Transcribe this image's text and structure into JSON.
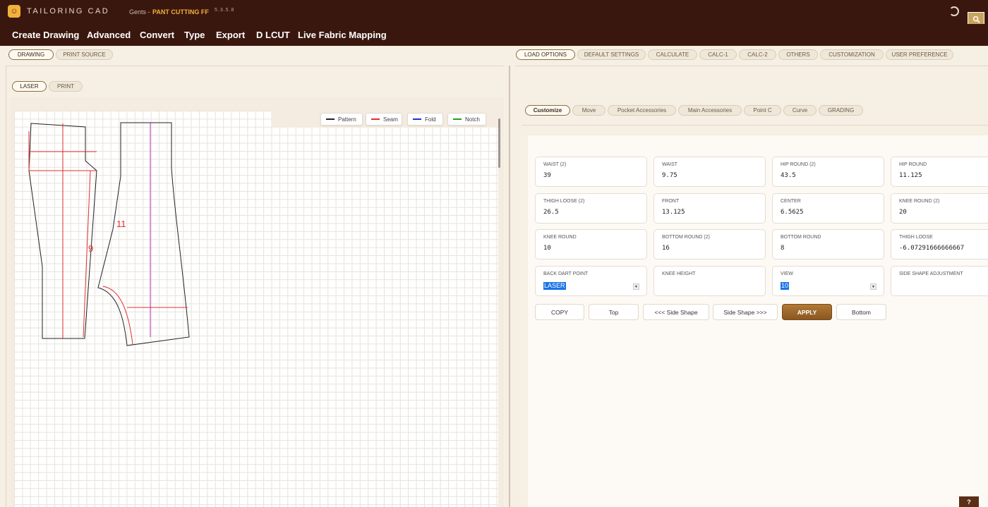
{
  "app": {
    "name": "TAILORING CAD",
    "breadcrumb_parent": "Gents -",
    "breadcrumb_current": "PANT CUTTING FF",
    "version": "5.3.5.8"
  },
  "menu": [
    "Create Drawing",
    "Advanced",
    "Convert",
    "Type",
    "Export",
    "D LCUT",
    "Live Fabric Mapping"
  ],
  "left_tabs": [
    "DRAWING",
    "PRINT SOURCE"
  ],
  "output_tabs": [
    "LASER",
    "PRINT"
  ],
  "right_tabs": [
    "LOAD OPTIONS",
    "DEFAULT SETTINGS",
    "CALCULATE",
    "CALC-1",
    "CALC-2",
    "OTHERS",
    "CUSTOMIZATION",
    "USER PREFERENCE"
  ],
  "sub_tabs": [
    "Customize",
    "Move",
    "Pocket Accessories",
    "Main Accessories",
    "Point C",
    "Curve",
    "GRADING"
  ],
  "legend": [
    {
      "label": "Pattern",
      "color": "#222222"
    },
    {
      "label": "Seam",
      "color": "#e03030"
    },
    {
      "label": "Fold",
      "color": "#2030d0"
    },
    {
      "label": "Notch",
      "color": "#20a020"
    }
  ],
  "pattern_labels": [
    "9",
    "11"
  ],
  "fields": [
    {
      "label": "WAIST (2)",
      "value": "39"
    },
    {
      "label": "WAIST",
      "value": "9.75"
    },
    {
      "label": "HIP ROUND (2)",
      "value": "43.5"
    },
    {
      "label": "HIP ROUND",
      "value": "11.125"
    },
    {
      "label": "THIGH LOOSE (2)",
      "value": "26.5"
    },
    {
      "label": "FRONT",
      "value": "13.125"
    },
    {
      "label": "CENTER",
      "value": "6.5625"
    },
    {
      "label": "KNEE ROUND (2)",
      "value": "20"
    },
    {
      "label": "KNEE ROUND",
      "value": "10"
    },
    {
      "label": "BOTTOM ROUND (2)",
      "value": "16"
    },
    {
      "label": "BOTTOM ROUND",
      "value": "8"
    },
    {
      "label": "THIGH LOOSE",
      "value": "-6.07291666666667"
    },
    {
      "label": "BACK DART POINT",
      "value": "LASER"
    },
    {
      "label": "KNEE HEIGHT",
      "value": ""
    },
    {
      "label": "VIEW",
      "value": "10"
    },
    {
      "label": "SIDE SHAPE ADJUSTMENT",
      "value": ""
    }
  ],
  "actions": [
    "COPY",
    "Top",
    "<<< Side Shape",
    "Side Shape >>>",
    "APPLY",
    "Bottom"
  ],
  "corner_button": "?",
  "colors": {
    "titlebar": "#3a170e",
    "accent": "#f2b13c",
    "apply": "#9a6528"
  }
}
